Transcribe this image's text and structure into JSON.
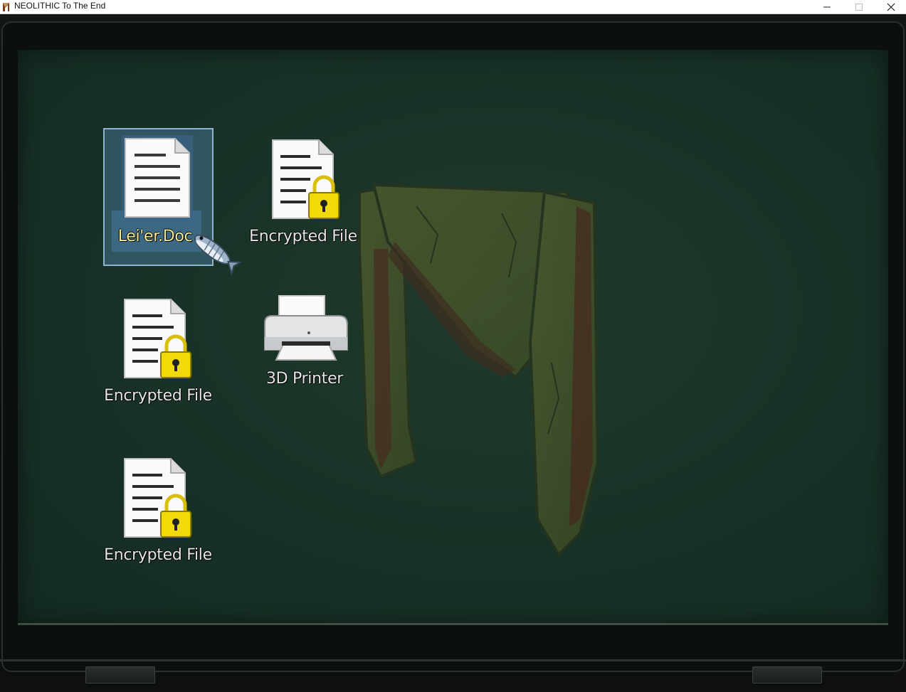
{
  "window": {
    "title": "NEOLITHIC To The End",
    "app_icon": "neolithic-n-icon",
    "controls": [
      "minimize-icon",
      "maximize-icon",
      "close-icon"
    ]
  },
  "desktop": {
    "wallpaper": "neolithic-n-logo",
    "icons": [
      {
        "label": "Lei'er.Doc",
        "icon": "document-icon",
        "selected": true
      },
      {
        "label": "Encrypted File",
        "icon": "locked-document-icon",
        "selected": false
      },
      {
        "label": "Encrypted File",
        "icon": "locked-document-icon",
        "selected": false
      },
      {
        "label": "3D Printer",
        "icon": "printer-icon",
        "selected": false
      },
      {
        "label": "Encrypted File",
        "icon": "locked-document-icon",
        "selected": false
      }
    ],
    "cursor": "fish-cursor-icon"
  },
  "colors": {
    "screen_bg": "#183126",
    "selection": "#8fb4cf",
    "selected_label": "#f3ec9a",
    "lock": "#f2d90a"
  }
}
